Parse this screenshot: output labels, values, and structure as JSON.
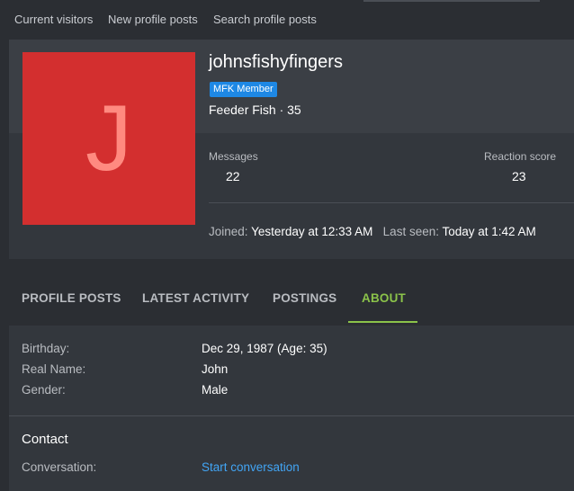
{
  "subnav": {
    "items": [
      "Current visitors",
      "New profile posts",
      "Search profile posts"
    ]
  },
  "profile": {
    "avatar_letter": "J",
    "username": "johnsfishyfingers",
    "badge": "MFK Member",
    "user_title": "Feeder Fish · 35",
    "stats": {
      "messages_label": "Messages",
      "messages_value": "22",
      "reaction_label": "Reaction score",
      "reaction_value": "23"
    },
    "joined_label": "Joined:",
    "joined_value": "Yesterday at 12:33 AM",
    "last_seen_label": "Last seen:",
    "last_seen_value": "Today at 1:42 AM"
  },
  "tabs": [
    "PROFILE POSTS",
    "LATEST ACTIVITY",
    "POSTINGS",
    "ABOUT"
  ],
  "about": {
    "rows": [
      {
        "label": "Birthday:",
        "value": "Dec 29, 1987 (Age: 35)"
      },
      {
        "label": "Real Name:",
        "value": "John"
      },
      {
        "label": "Gender:",
        "value": "Male"
      }
    ],
    "contact_title": "Contact",
    "conversation_label": "Conversation:",
    "conversation_link": "Start conversation"
  },
  "colors": {
    "avatar_bg": "#d32f2f",
    "avatar_letter": "#ff8a80",
    "badge_bg": "#1e88e5",
    "active_tab": "#8bc34a",
    "link": "#42a5f5"
  }
}
